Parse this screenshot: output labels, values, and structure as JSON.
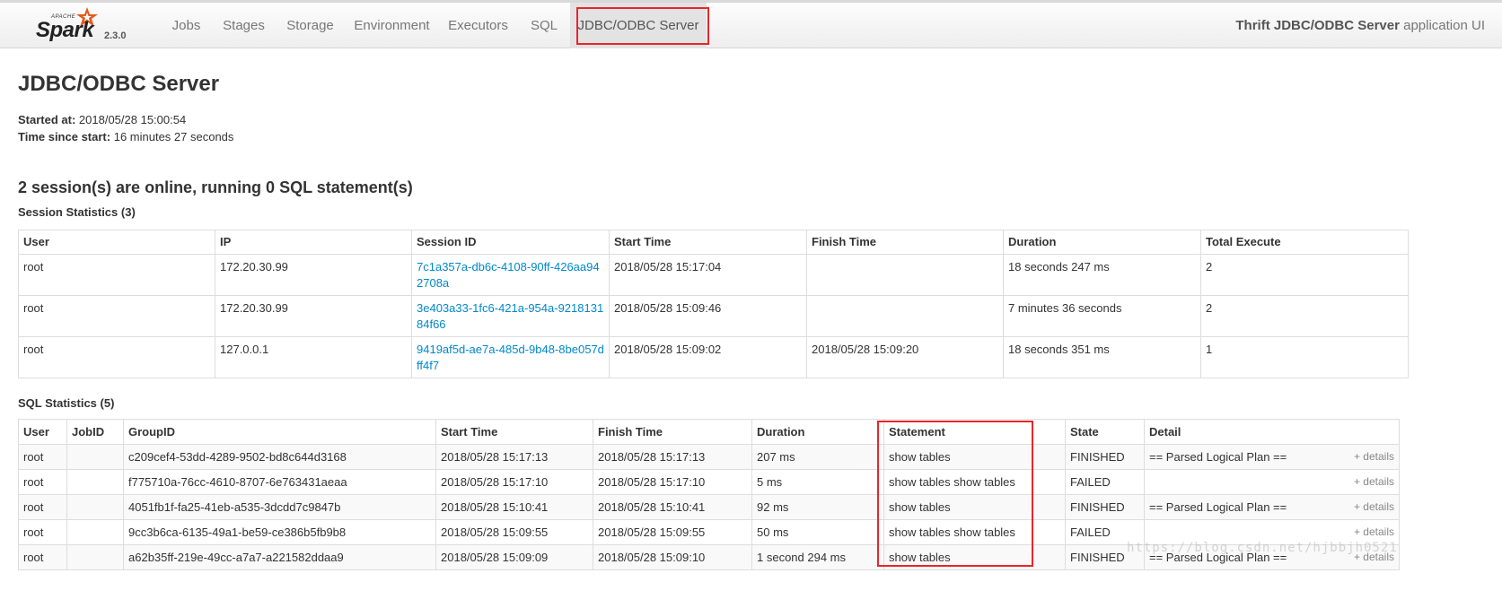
{
  "nav": {
    "version": "2.3.0",
    "brand_apache": "APACHE",
    "brand_spark": "Spark",
    "items": [
      {
        "label": "Jobs"
      },
      {
        "label": "Stages"
      },
      {
        "label": "Storage"
      },
      {
        "label": "Environment"
      },
      {
        "label": "Executors"
      },
      {
        "label": "SQL"
      },
      {
        "label": "JDBC/ODBC Server",
        "active": true
      }
    ],
    "app_name": "Thrift JDBC/ODBC Server",
    "app_suffix": "application UI"
  },
  "page": {
    "title": "JDBC/ODBC Server",
    "started_label": "Started at:",
    "started_value": "2018/05/28 15:00:54",
    "elapsed_label": "Time since start:",
    "elapsed_value": "16 minutes 27 seconds",
    "summary": "2 session(s) are online, running 0 SQL statement(s)"
  },
  "session_stats": {
    "heading": "Session Statistics (3)",
    "columns": [
      "User",
      "IP",
      "Session ID",
      "Start Time",
      "Finish Time",
      "Duration",
      "Total Execute"
    ],
    "rows": [
      {
        "user": "root",
        "ip": "172.20.30.99",
        "session_id": "7c1a357a-db6c-4108-90ff-426aa942708a",
        "start": "2018/05/28 15:17:04",
        "finish": "",
        "duration": "18 seconds 247 ms",
        "total": "2"
      },
      {
        "user": "root",
        "ip": "172.20.30.99",
        "session_id": "3e403a33-1fc6-421a-954a-921813184f66",
        "start": "2018/05/28 15:09:46",
        "finish": "",
        "duration": "7 minutes 36 seconds",
        "total": "2"
      },
      {
        "user": "root",
        "ip": "127.0.0.1",
        "session_id": "9419af5d-ae7a-485d-9b48-8be057dff4f7",
        "start": "2018/05/28 15:09:02",
        "finish": "2018/05/28 15:09:20",
        "duration": "18 seconds 351 ms",
        "total": "1"
      }
    ]
  },
  "sql_stats": {
    "heading": "SQL Statistics (5)",
    "columns": [
      "User",
      "JobID",
      "GroupID",
      "Start Time",
      "Finish Time",
      "Duration",
      "Statement",
      "State",
      "Detail"
    ],
    "details_label": "+ details",
    "rows": [
      {
        "user": "root",
        "job": "",
        "group": "c209cef4-53dd-4289-9502-bd8c644d3168",
        "start": "2018/05/28 15:17:13",
        "finish": "2018/05/28 15:17:13",
        "duration": "207 ms",
        "statement": "show tables",
        "state": "FINISHED",
        "detail": "== Parsed Logical Plan =="
      },
      {
        "user": "root",
        "job": "",
        "group": "f775710a-76cc-4610-8707-6e763431aeaa",
        "start": "2018/05/28 15:17:10",
        "finish": "2018/05/28 15:17:10",
        "duration": "5 ms",
        "statement": "show tables show tables",
        "state": "FAILED",
        "detail": ""
      },
      {
        "user": "root",
        "job": "",
        "group": "4051fb1f-fa25-41eb-a535-3dcdd7c9847b",
        "start": "2018/05/28 15:10:41",
        "finish": "2018/05/28 15:10:41",
        "duration": "92 ms",
        "statement": "show tables",
        "state": "FINISHED",
        "detail": "== Parsed Logical Plan =="
      },
      {
        "user": "root",
        "job": "",
        "group": "9cc3b6ca-6135-49a1-be59-ce386b5fb9b8",
        "start": "2018/05/28 15:09:55",
        "finish": "2018/05/28 15:09:55",
        "duration": "50 ms",
        "statement": "show tables show tables",
        "state": "FAILED",
        "detail": ""
      },
      {
        "user": "root",
        "job": "",
        "group": "a62b35ff-219e-49cc-a7a7-a221582ddaa9",
        "start": "2018/05/28 15:09:09",
        "finish": "2018/05/28 15:09:10",
        "duration": "1 second 294 ms",
        "statement": "show tables",
        "state": "FINISHED",
        "detail": "== Parsed Logical Plan =="
      }
    ]
  },
  "watermark": "https://blog.csdn.net/hjbbjh0521",
  "colors": {
    "link": "#0088cc",
    "highlight": "#e8262a",
    "brand_star": "#e25a1c"
  }
}
